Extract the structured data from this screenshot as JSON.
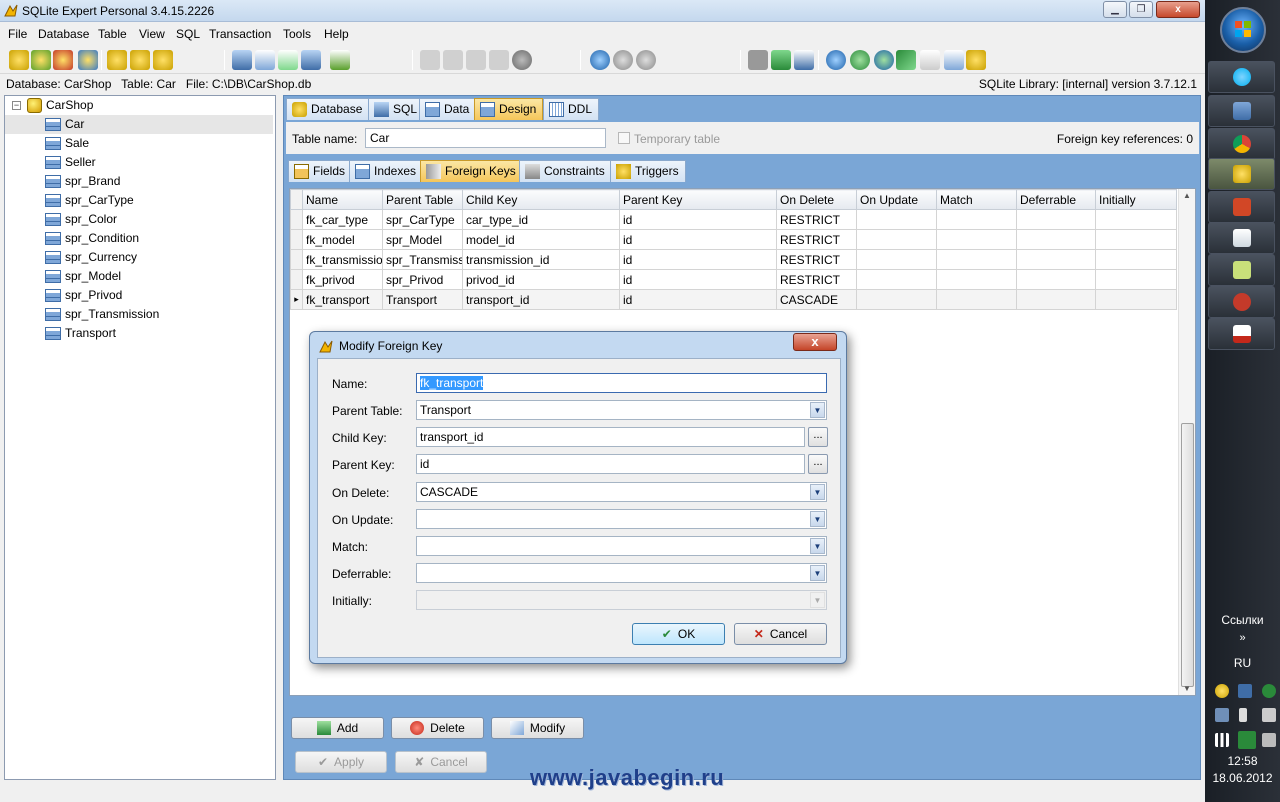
{
  "window": {
    "title": "SQLite Expert Personal 3.4.15.2226"
  },
  "menu": [
    "File",
    "Database",
    "Table",
    "View",
    "SQL",
    "Transaction",
    "Tools",
    "Help"
  ],
  "infobar": {
    "left": "Database: CarShop   Table: Car   File: C:\\DB\\CarShop.db",
    "right": "SQLite Library: [internal] version 3.7.12.1"
  },
  "tree": {
    "root": "CarShop",
    "items": [
      "Car",
      "Sale",
      "Seller",
      "spr_Brand",
      "spr_CarType",
      "spr_Color",
      "spr_Condition",
      "spr_Currency",
      "spr_Model",
      "spr_Privod",
      "spr_Transmission",
      "Transport"
    ],
    "selected": "Car"
  },
  "tabs": [
    "Database",
    "SQL",
    "Data",
    "Design",
    "DDL"
  ],
  "active_tab": "Design",
  "table_panel": {
    "name_label": "Table name:",
    "name_value": "Car",
    "temporary_label": "Temporary table",
    "fk_references": "Foreign key references: 0"
  },
  "subtabs": [
    "Fields",
    "Indexes",
    "Foreign Keys",
    "Constraints",
    "Triggers"
  ],
  "active_subtab": "Foreign Keys",
  "grid": {
    "columns": [
      "Name",
      "Parent Table",
      "Child Key",
      "Parent Key",
      "On Delete",
      "On Update",
      "Match",
      "Deferrable",
      "Initially"
    ],
    "rows": [
      [
        "fk_car_type",
        "spr_CarType",
        "car_type_id",
        "id",
        "RESTRICT",
        "",
        "",
        "",
        ""
      ],
      [
        "fk_model",
        "spr_Model",
        "model_id",
        "id",
        "RESTRICT",
        "",
        "",
        "",
        ""
      ],
      [
        "fk_transmissio",
        "spr_Transmiss",
        "transmission_id",
        "id",
        "RESTRICT",
        "",
        "",
        "",
        ""
      ],
      [
        "fk_privod",
        "spr_Privod",
        "privod_id",
        "id",
        "RESTRICT",
        "",
        "",
        "",
        ""
      ],
      [
        "fk_transport",
        "Transport",
        "transport_id",
        "id",
        "CASCADE",
        "",
        "",
        "",
        ""
      ]
    ],
    "current_row_marker": "▸"
  },
  "grid_buttons": {
    "add": "Add",
    "delete": "Delete",
    "modify": "Modify"
  },
  "footer_buttons": {
    "apply": "Apply",
    "cancel": "Cancel"
  },
  "watermark": "www.javabegin.ru",
  "dialog": {
    "title": "Modify Foreign Key",
    "close": "x",
    "fields": {
      "name": {
        "label": "Name:",
        "value": "fk_transport"
      },
      "parent_table": {
        "label": "Parent Table:",
        "value": "Transport"
      },
      "child_key": {
        "label": "Child Key:",
        "value": "transport_id"
      },
      "parent_key": {
        "label": "Parent Key:",
        "value": "id"
      },
      "on_delete": {
        "label": "On Delete:",
        "value": "CASCADE"
      },
      "on_update": {
        "label": "On Update:",
        "value": ""
      },
      "match": {
        "label": "Match:",
        "value": ""
      },
      "deferrable": {
        "label": "Deferrable:",
        "value": ""
      },
      "initially": {
        "label": "Initially:",
        "value": ""
      }
    },
    "ellipsis": "...",
    "ok": "OK",
    "cancel": "Cancel"
  },
  "taskbar": {
    "links_label": "Ссылки",
    "chevron": "»",
    "lang": "RU",
    "time": "12:58",
    "date": "18.06.2012"
  },
  "colors": {
    "panel_blue": "#7aa6d6",
    "tab_active": "#f5c65a",
    "selection": "#3399ff"
  }
}
